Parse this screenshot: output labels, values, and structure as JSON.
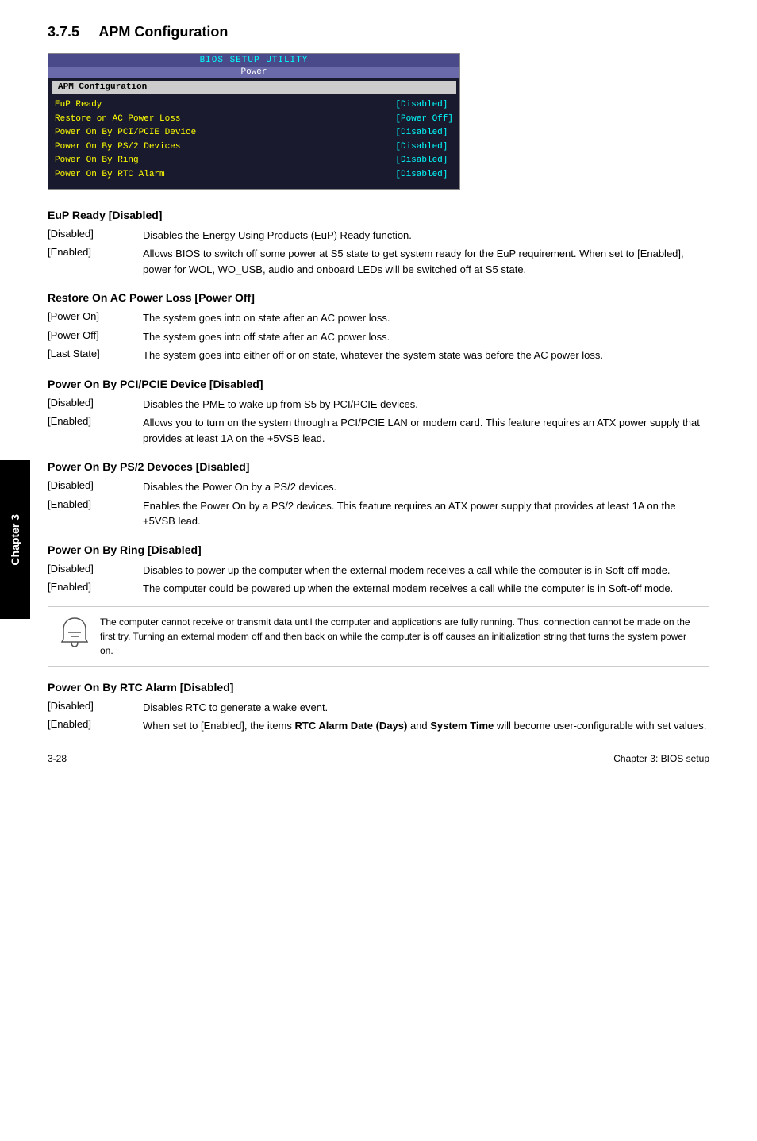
{
  "section": {
    "number": "3.7.5",
    "title": "APM Configuration"
  },
  "bios": {
    "header": "BIOS SETUP UTILITY",
    "sub_header": "Power",
    "section_title": "APM Configuration",
    "items": [
      {
        "label": "EuP Ready",
        "value": "[Disabled]"
      },
      {
        "label": "Restore on AC Power Loss",
        "value": "[Power Off]"
      },
      {
        "label": "Power On By PCI/PCIE Device",
        "value": "[Disabled]"
      },
      {
        "label": "Power On By PS/2 Devices",
        "value": "[Disabled]"
      },
      {
        "label": "Power On By Ring",
        "value": "[Disabled]"
      },
      {
        "label": "Power On By RTC Alarm",
        "value": "[Disabled]"
      }
    ]
  },
  "subsections": [
    {
      "id": "eup",
      "title": "EuP Ready [Disabled]",
      "definitions": [
        {
          "term": "[Disabled]",
          "desc": "Disables the Energy Using Products (EuP) Ready function."
        },
        {
          "term": "[Enabled]",
          "desc": "Allows BIOS to switch off some power at S5 state to get system ready for the EuP requirement. When set to [Enabled], power for WOL, WO_USB, audio and onboard LEDs will be switched off at S5 state."
        }
      ]
    },
    {
      "id": "restore-ac",
      "title": "Restore On AC Power Loss [Power Off]",
      "definitions": [
        {
          "term": "[Power On]",
          "desc": "The system goes into on state after an AC power loss."
        },
        {
          "term": "[Power Off]",
          "desc": "The system goes into off state after an AC power loss."
        },
        {
          "term": "[Last State]",
          "desc": "The system goes into either off or on state, whatever the system state was before the AC power loss."
        }
      ]
    },
    {
      "id": "pci-pcie",
      "title": "Power On By PCI/PCIE Device [Disabled]",
      "definitions": [
        {
          "term": "[Disabled]",
          "desc": "Disables the PME to wake up from S5 by PCI/PCIE devices."
        },
        {
          "term": "[Enabled]",
          "desc": "Allows you to turn on the system through a PCI/PCIE LAN or modem card. This feature requires an ATX power supply that provides at least 1A on the +5VSB lead."
        }
      ]
    },
    {
      "id": "ps2",
      "title": "Power On By PS/2 Devoces [Disabled]",
      "definitions": [
        {
          "term": "[Disabled]",
          "desc": "Disables the Power On by a PS/2 devices."
        },
        {
          "term": "[Enabled]",
          "desc": "Enables the Power On by a PS/2 devices. This feature requires an ATX power supply that provides at least 1A on the +5VSB lead."
        }
      ]
    },
    {
      "id": "ring",
      "title": "Power On By Ring [Disabled]",
      "definitions": [
        {
          "term": "[Disabled]",
          "desc": "Disables to power up the computer when the external modem receives a call while the computer is in Soft-off mode."
        },
        {
          "term": "[Enabled]",
          "desc": "The computer could be powered up when the external modem receives a call while the computer is in Soft-off mode."
        }
      ],
      "note": "The computer cannot receive or transmit data until the computer and applications are fully running. Thus, connection cannot be made on the first try. Turning an external modem off and then back on while the computer is off causes an initialization string that turns the system power on."
    },
    {
      "id": "rtc",
      "title": "Power On By RTC Alarm [Disabled]",
      "definitions": [
        {
          "term": "[Disabled]",
          "desc": "Disables RTC to generate a wake event."
        },
        {
          "term": "[Enabled]",
          "desc": "When set to [Enabled], the items RTC Alarm Date (Days) and System Time will become user-configurable with set values."
        }
      ]
    }
  ],
  "rtc_enabled_bold_parts": "RTC Alarm Date (Days) and System Time",
  "chapter_label": "Chapter 3",
  "footer": {
    "left": "3-28",
    "right": "Chapter 3: BIOS setup"
  }
}
